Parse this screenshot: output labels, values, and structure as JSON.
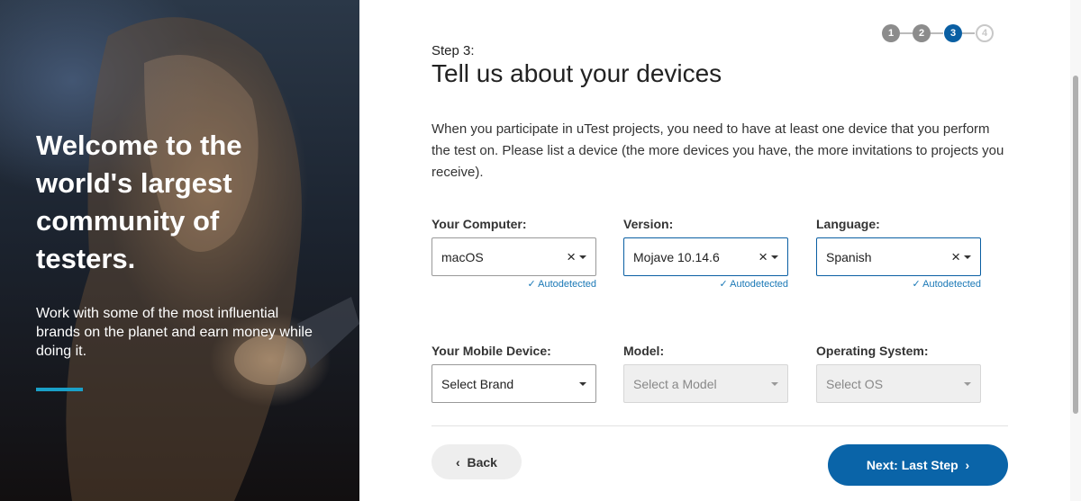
{
  "hero": {
    "heading": "Welcome to the world's largest community of testers.",
    "text": "Work with some of the most influential brands on the planet and earn money while doing it."
  },
  "progress": {
    "steps": [
      "1",
      "2",
      "3",
      "4"
    ],
    "current": 3
  },
  "form": {
    "step_label": "Step 3:",
    "title": "Tell us about your devices",
    "intro": "When you participate in uTest projects, you need to have at least one device that you perform the test on. Please list a device (the more devices you have, the more invitations to projects you receive).",
    "computer": {
      "label": "Your Computer:",
      "value": "macOS",
      "note": "Autodetected"
    },
    "version": {
      "label": "Version:",
      "value": "Mojave 10.14.6",
      "note": "Autodetected"
    },
    "language": {
      "label": "Language:",
      "value": "Spanish",
      "note": "Autodetected"
    },
    "mobile": {
      "label": "Your Mobile Device:",
      "value": "Select Brand"
    },
    "model": {
      "label": "Model:",
      "value": "Select a Model"
    },
    "os": {
      "label": "Operating System:",
      "value": "Select OS"
    }
  },
  "buttons": {
    "back": "Back",
    "next": "Next: Last Step"
  },
  "colors": {
    "accent": "#0a5fa3",
    "hero_bar": "#1aa0c8"
  }
}
